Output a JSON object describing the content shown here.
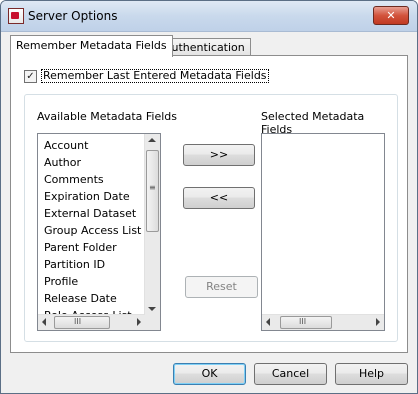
{
  "window": {
    "title": "Server Options",
    "close_glyph": "✕",
    "icon": "app-icon"
  },
  "tabs": [
    {
      "label": "Remember Metadata Fields",
      "active": true
    },
    {
      "label": "Authentication",
      "active": false
    }
  ],
  "remember": {
    "label": "Remember Last Entered Metadata Fields",
    "checked": true,
    "check_glyph": "✓"
  },
  "available": {
    "label": "Available Metadata Fields",
    "items": [
      "Account",
      "Author",
      "Comments",
      "Expiration Date",
      "External Dataset",
      "Group Access List",
      "Parent Folder",
      "Partition ID",
      "Profile",
      "Release Date",
      "Role Access List"
    ]
  },
  "selected": {
    "label": "Selected Metadata Fields",
    "items": []
  },
  "buttons": {
    "add": ">>",
    "remove": "<<",
    "reset": "Reset",
    "ok": "OK",
    "cancel": "Cancel",
    "help": "Help"
  },
  "scroll_grip": "≡",
  "hscroll_grip": "III"
}
